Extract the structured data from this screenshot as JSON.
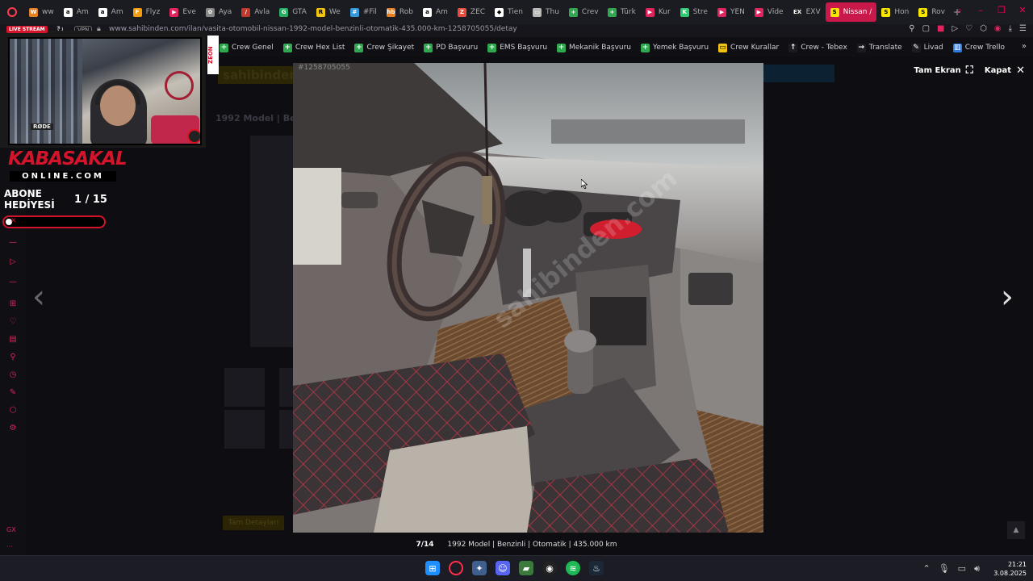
{
  "tabs": [
    {
      "label": "ww",
      "color": "#e67e22",
      "glyph": "W"
    },
    {
      "label": "Am",
      "color": "#ffffff",
      "glyph": "a"
    },
    {
      "label": "Am",
      "color": "#ffffff",
      "glyph": "a"
    },
    {
      "label": "Flyz",
      "color": "#f39c12",
      "glyph": "F"
    },
    {
      "label": "Eve",
      "color": "#e0245e",
      "glyph": "▶"
    },
    {
      "label": "Aya",
      "color": "#888888",
      "glyph": "✿"
    },
    {
      "label": "Avla",
      "color": "#c0392b",
      "glyph": "/"
    },
    {
      "label": "GTA",
      "color": "#27ae60",
      "glyph": "G"
    },
    {
      "label": "We",
      "color": "#f1c40f",
      "glyph": "R"
    },
    {
      "label": "#Fil",
      "color": "#3498db",
      "glyph": "#"
    },
    {
      "label": "Rob",
      "color": "#e67e22",
      "glyph": "hb"
    },
    {
      "label": "Am",
      "color": "#ffffff",
      "glyph": "a"
    },
    {
      "label": "ZEC",
      "color": "#e74c3c",
      "glyph": "Z"
    },
    {
      "label": "Tien",
      "color": "#ffffff",
      "glyph": "◆"
    },
    {
      "label": "Thu",
      "color": "#bbbbbb",
      "glyph": "▭"
    },
    {
      "label": "Crev",
      "color": "#2fa84f",
      "glyph": "+"
    },
    {
      "label": "Türk",
      "color": "#2fa84f",
      "glyph": "+"
    },
    {
      "label": "Kur",
      "color": "#e0245e",
      "glyph": "▶"
    },
    {
      "label": "Stre",
      "color": "#2ecc71",
      "glyph": "K"
    },
    {
      "label": "YEN",
      "color": "#e0245e",
      "glyph": "▶"
    },
    {
      "label": "Vide",
      "color": "#e0245e",
      "glyph": "▶"
    },
    {
      "label": "EXV",
      "color": "#222222",
      "glyph": "EX"
    },
    {
      "label": "Nissan /",
      "color": "#f7e600",
      "glyph": "S",
      "active": true
    },
    {
      "label": "Hon",
      "color": "#f7e600",
      "glyph": "S"
    },
    {
      "label": "Rov",
      "color": "#f7e600",
      "glyph": "S"
    }
  ],
  "address": {
    "url": "www.sahibinden.com/ilan/vasita-otomobil-nissan-1992-model-benzinli-otomatik-435.000-km-1258705055/detay",
    "vpn": "VPN"
  },
  "bookmarks": [
    {
      "label": "Crew Genel",
      "color": "#2fa84f",
      "glyph": "+"
    },
    {
      "label": "Crew Hex List",
      "color": "#2fa84f",
      "glyph": "+"
    },
    {
      "label": "Crew Şikayet",
      "color": "#2fa84f",
      "glyph": "+"
    },
    {
      "label": "PD Başvuru",
      "color": "#2fa84f",
      "glyph": "+"
    },
    {
      "label": "EMS Başvuru",
      "color": "#2fa84f",
      "glyph": "+"
    },
    {
      "label": "Mekanik Başvuru",
      "color": "#2fa84f",
      "glyph": "+"
    },
    {
      "label": "Yemek Başvuru",
      "color": "#2fa84f",
      "glyph": "+"
    },
    {
      "label": "Crew Kurallar",
      "color": "#f1c40f",
      "glyph": "▭"
    },
    {
      "label": "Crew - Tebex",
      "color": "#1b1b22",
      "glyph": "↑"
    },
    {
      "label": "Translate",
      "color": "#1b1b22",
      "glyph": "→"
    },
    {
      "label": "Livad",
      "color": "#1b1b22",
      "glyph": "✎"
    },
    {
      "label": "Crew Trello",
      "color": "#2d7be5",
      "glyph": "▥"
    }
  ],
  "stream": {
    "live": "LIVE STREAM",
    "zeon": "ZEON",
    "rode": "RØDE",
    "brand_top": "KABASAKAL",
    "brand_bottom": "ONLINE.COM",
    "abone": "ABONE HEDİYESİ",
    "abone_count": "1 / 15",
    "progress": 0.07
  },
  "page": {
    "logo": "sahibinden.com",
    "title": "1992 Model | Be",
    "search_btn": "Tam Detayları"
  },
  "viewer": {
    "fullscreen": "Tam Ekran",
    "close": "Kapat",
    "photo_id": "#1258705055",
    "counter": "7/14",
    "caption": "1992 Model | Benzinli | Otomatik | 435.000 km",
    "watermark": "sahibinden.com"
  },
  "clock": {
    "time": "21:21",
    "date": "3.08.2025"
  }
}
